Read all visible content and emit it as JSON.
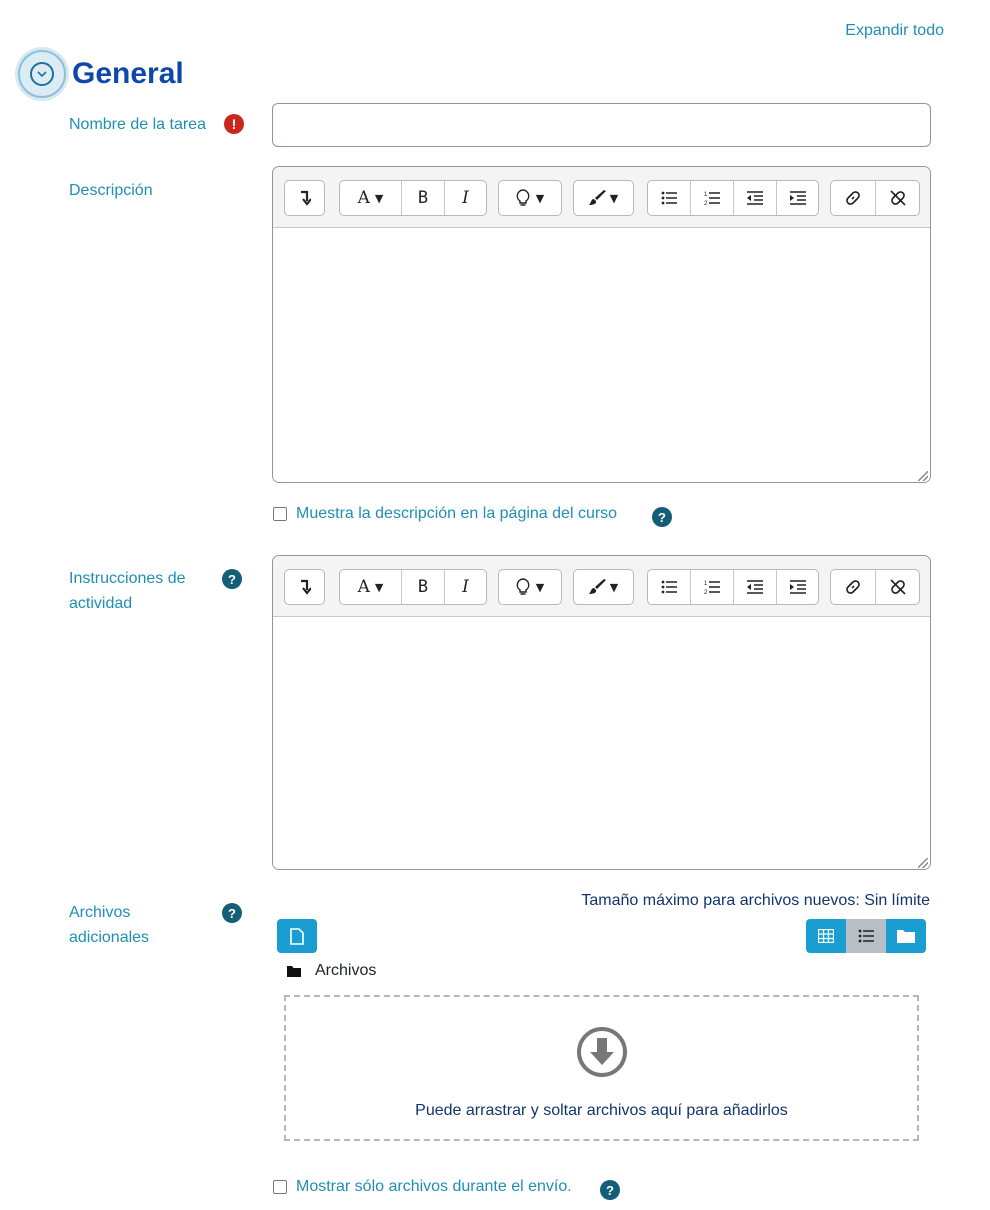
{
  "header": {
    "expand_all": "Expandir todo",
    "section_title": "General"
  },
  "fields": {
    "task_name": {
      "label": "Nombre de la tarea",
      "value": ""
    },
    "description": {
      "label": "Descripción"
    },
    "show_description": {
      "label": "Muestra la descripción en la página del curso",
      "checked": false
    },
    "activity_instructions": {
      "label_line1": "Instrucciones de",
      "label_line2": "actividad"
    },
    "additional_files": {
      "label_line1": "Archivos",
      "label_line2": "adicionales",
      "max_size": "Tamaño máximo para archivos nuevos: Sin límite",
      "folder_name": "Archivos",
      "drop_hint": "Puede arrastrar y soltar archivos aquí para añadirlos"
    },
    "only_files": {
      "label": "Mostrar sólo archivos durante el envío.",
      "checked": false
    }
  },
  "toolbar": {
    "bold": "B",
    "italic": "I",
    "font_letter": "A"
  },
  "icons": {
    "required": "exclamation-icon",
    "help": "question-icon",
    "collapse": "chevron-down-icon"
  },
  "help_mark": "?",
  "required_mark": "!",
  "colors": {
    "link": "#1f8fb4",
    "title": "#0f47ad",
    "primary_button": "#1a9ed1",
    "help": "#155e79",
    "required": "#c8281e"
  }
}
